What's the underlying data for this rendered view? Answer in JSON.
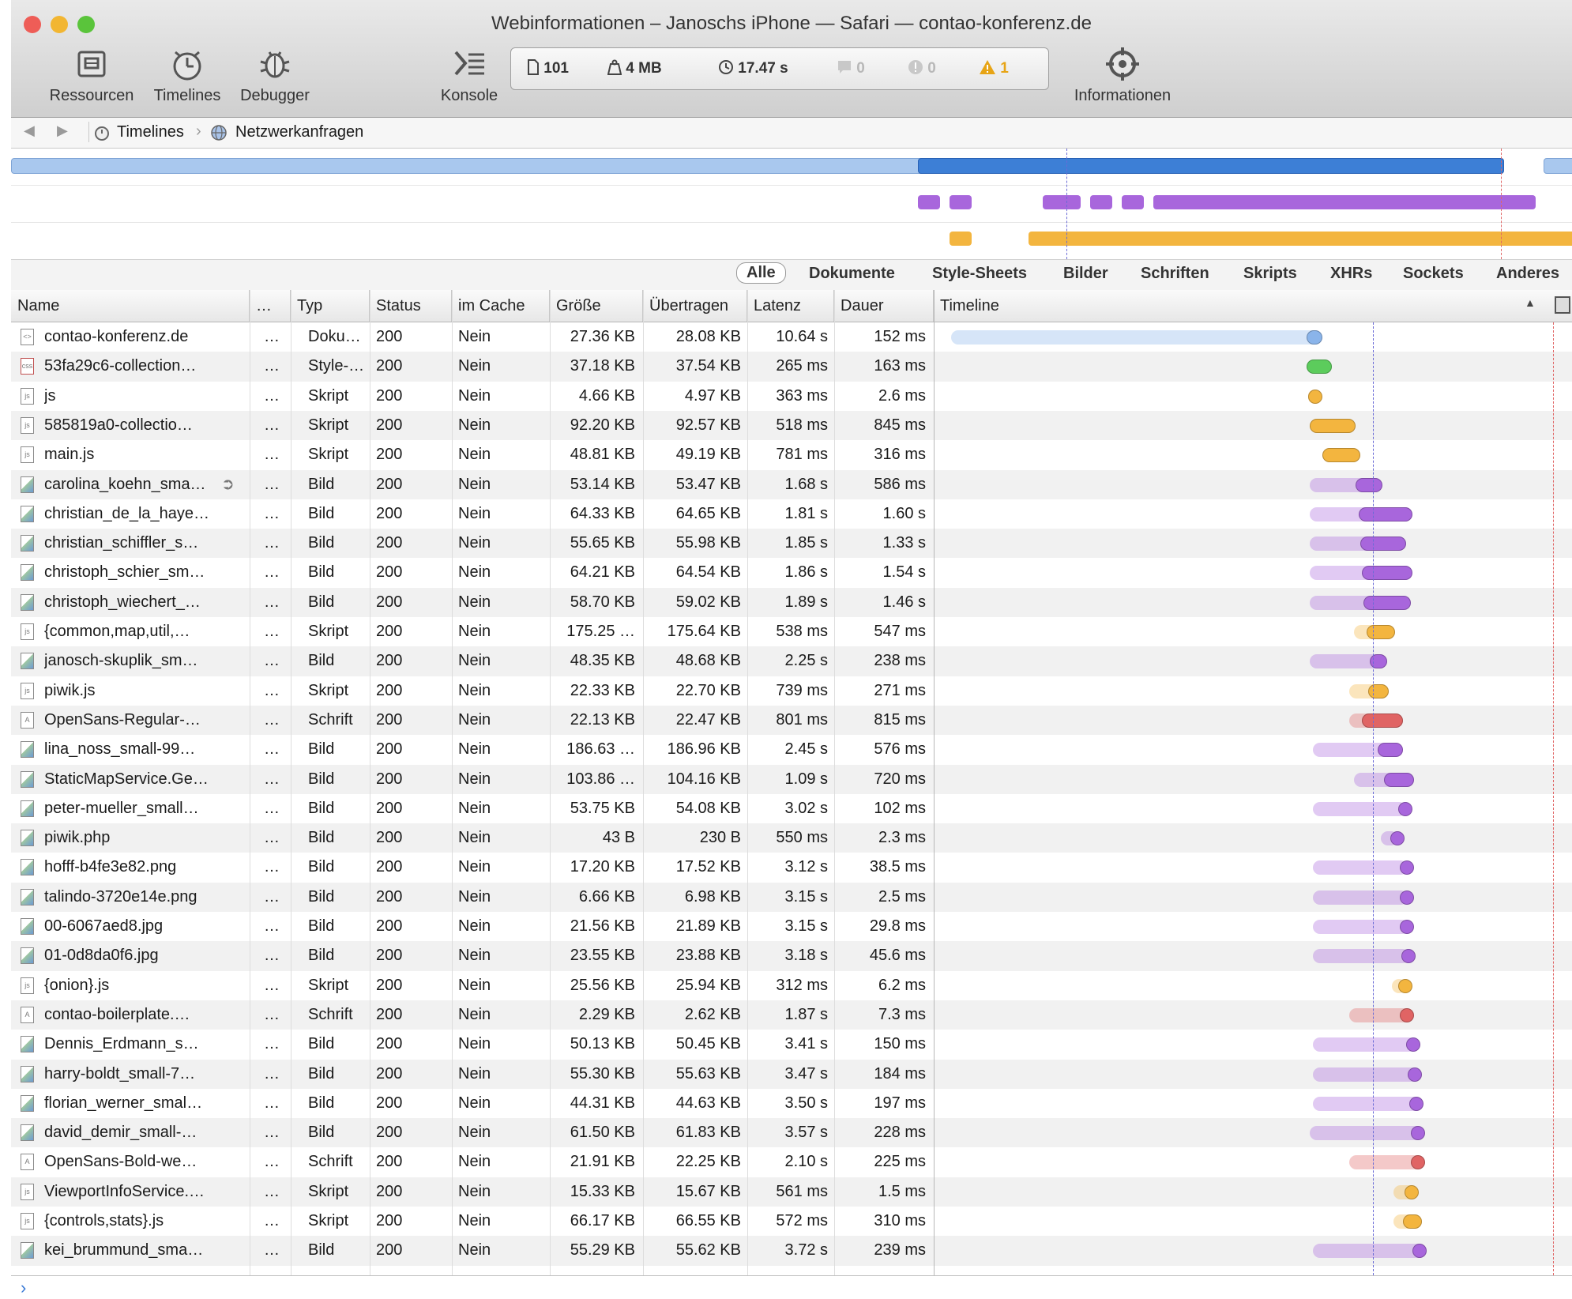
{
  "window": {
    "title": "Webinformationen – Janoschs iPhone — Safari — contao-konferenz.de",
    "traffic_colors": [
      "#ee5d57",
      "#f2b632",
      "#5ac43b"
    ]
  },
  "toolbar": {
    "resources_label": "Ressourcen",
    "timelines_label": "Timelines",
    "debugger_label": "Debugger",
    "console_label": "Konsole",
    "info_label": "Informationen"
  },
  "stats": {
    "resources": "101",
    "size": "4 MB",
    "time": "17.47 s",
    "messages": "0",
    "errors": "0",
    "warnings": "1",
    "warning_color": "#e7a415"
  },
  "breadcrumb": {
    "item1": "Timelines",
    "item2": "Netzwerkanfragen"
  },
  "filters": [
    "Alle",
    "Dokumente",
    "Style-Sheets",
    "Bilder",
    "Schriften",
    "Skripts",
    "XHRs",
    "Sockets",
    "Anderes"
  ],
  "columns": {
    "name": "Name",
    "dots": "…",
    "type": "Typ",
    "status": "Status",
    "cache": "im Cache",
    "size": "Größe",
    "transferred": "Übertragen",
    "latency": "Latenz",
    "duration": "Dauer",
    "timeline": "Timeline"
  },
  "colors": {
    "document": "#8ab4ea",
    "stylesheet": "#5ccc5c",
    "script": "#f3b53f",
    "image": "#a866dc",
    "font": "#e06464"
  },
  "rows": [
    {
      "name": "contao-konferenz.de",
      "dots": "…",
      "type": "Doku…",
      "status": "200",
      "cache": "Nein",
      "size": "27.36 KB",
      "transferred": "28.08 KB",
      "latency": "10.64 s",
      "duration": "152 ms",
      "kind": "document",
      "icon": "<>"
    },
    {
      "name": "53fa29c6-collection…",
      "dots": "…",
      "type": "Style-…",
      "status": "200",
      "cache": "Nein",
      "size": "37.18 KB",
      "transferred": "37.54 KB",
      "latency": "265 ms",
      "duration": "163 ms",
      "kind": "stylesheet",
      "icon": "css"
    },
    {
      "name": "js",
      "dots": "…",
      "type": "Skript",
      "status": "200",
      "cache": "Nein",
      "size": "4.66 KB",
      "transferred": "4.97 KB",
      "latency": "363 ms",
      "duration": "2.6 ms",
      "kind": "script",
      "icon": "js"
    },
    {
      "name": "585819a0-collectio…",
      "dots": "…",
      "type": "Skript",
      "status": "200",
      "cache": "Nein",
      "size": "92.20 KB",
      "transferred": "92.57 KB",
      "latency": "518 ms",
      "duration": "845 ms",
      "kind": "script",
      "icon": "js"
    },
    {
      "name": "main.js",
      "dots": "…",
      "type": "Skript",
      "status": "200",
      "cache": "Nein",
      "size": "48.81 KB",
      "transferred": "49.19 KB",
      "latency": "781 ms",
      "duration": "316 ms",
      "kind": "script",
      "icon": "js"
    },
    {
      "name": "carolina_koehn_sma…",
      "dots": "…",
      "type": "Bild",
      "status": "200",
      "cache": "Nein",
      "size": "53.14 KB",
      "transferred": "53.47 KB",
      "latency": "1.68 s",
      "duration": "586 ms",
      "kind": "image",
      "icon": "img"
    },
    {
      "name": "christian_de_la_haye…",
      "dots": "…",
      "type": "Bild",
      "status": "200",
      "cache": "Nein",
      "size": "64.33 KB",
      "transferred": "64.65 KB",
      "latency": "1.81 s",
      "duration": "1.60 s",
      "kind": "image",
      "icon": "img"
    },
    {
      "name": "christian_schiffler_s…",
      "dots": "…",
      "type": "Bild",
      "status": "200",
      "cache": "Nein",
      "size": "55.65 KB",
      "transferred": "55.98 KB",
      "latency": "1.85 s",
      "duration": "1.33 s",
      "kind": "image",
      "icon": "img"
    },
    {
      "name": "christoph_schier_sm…",
      "dots": "…",
      "type": "Bild",
      "status": "200",
      "cache": "Nein",
      "size": "64.21 KB",
      "transferred": "64.54 KB",
      "latency": "1.86 s",
      "duration": "1.54 s",
      "kind": "image",
      "icon": "img"
    },
    {
      "name": "christoph_wiechert_…",
      "dots": "…",
      "type": "Bild",
      "status": "200",
      "cache": "Nein",
      "size": "58.70 KB",
      "transferred": "59.02 KB",
      "latency": "1.89 s",
      "duration": "1.46 s",
      "kind": "image",
      "icon": "img"
    },
    {
      "name": "{common,map,util,…",
      "dots": "…",
      "type": "Skript",
      "status": "200",
      "cache": "Nein",
      "size": "175.25 …",
      "transferred": "175.64 KB",
      "latency": "538 ms",
      "duration": "547 ms",
      "kind": "script",
      "icon": "js"
    },
    {
      "name": "janosch-skuplik_sm…",
      "dots": "…",
      "type": "Bild",
      "status": "200",
      "cache": "Nein",
      "size": "48.35 KB",
      "transferred": "48.68 KB",
      "latency": "2.25 s",
      "duration": "238 ms",
      "kind": "image",
      "icon": "img"
    },
    {
      "name": "piwik.js",
      "dots": "…",
      "type": "Skript",
      "status": "200",
      "cache": "Nein",
      "size": "22.33 KB",
      "transferred": "22.70 KB",
      "latency": "739 ms",
      "duration": "271 ms",
      "kind": "script",
      "icon": "js"
    },
    {
      "name": "OpenSans-Regular-…",
      "dots": "…",
      "type": "Schrift",
      "status": "200",
      "cache": "Nein",
      "size": "22.13 KB",
      "transferred": "22.47 KB",
      "latency": "801 ms",
      "duration": "815 ms",
      "kind": "font",
      "icon": "A"
    },
    {
      "name": "lina_noss_small-99…",
      "dots": "…",
      "type": "Bild",
      "status": "200",
      "cache": "Nein",
      "size": "186.63 …",
      "transferred": "186.96 KB",
      "latency": "2.45 s",
      "duration": "576 ms",
      "kind": "image",
      "icon": "img"
    },
    {
      "name": "StaticMapService.Ge…",
      "dots": "…",
      "type": "Bild",
      "status": "200",
      "cache": "Nein",
      "size": "103.86 …",
      "transferred": "104.16 KB",
      "latency": "1.09 s",
      "duration": "720 ms",
      "kind": "image",
      "icon": "img"
    },
    {
      "name": "peter-mueller_small…",
      "dots": "…",
      "type": "Bild",
      "status": "200",
      "cache": "Nein",
      "size": "53.75 KB",
      "transferred": "54.08 KB",
      "latency": "3.02 s",
      "duration": "102 ms",
      "kind": "image",
      "icon": "img"
    },
    {
      "name": "piwik.php",
      "dots": "…",
      "type": "Bild",
      "status": "200",
      "cache": "Nein",
      "size": "43 B",
      "transferred": "230 B",
      "latency": "550 ms",
      "duration": "2.3 ms",
      "kind": "image",
      "icon": "img"
    },
    {
      "name": "hofff-b4fe3e82.png",
      "dots": "…",
      "type": "Bild",
      "status": "200",
      "cache": "Nein",
      "size": "17.20 KB",
      "transferred": "17.52 KB",
      "latency": "3.12 s",
      "duration": "38.5 ms",
      "kind": "image",
      "icon": "img"
    },
    {
      "name": "talindo-3720e14e.png",
      "dots": "…",
      "type": "Bild",
      "status": "200",
      "cache": "Nein",
      "size": "6.66 KB",
      "transferred": "6.98 KB",
      "latency": "3.15 s",
      "duration": "2.5 ms",
      "kind": "image",
      "icon": "img"
    },
    {
      "name": "00-6067aed8.jpg",
      "dots": "…",
      "type": "Bild",
      "status": "200",
      "cache": "Nein",
      "size": "21.56 KB",
      "transferred": "21.89 KB",
      "latency": "3.15 s",
      "duration": "29.8 ms",
      "kind": "image",
      "icon": "img"
    },
    {
      "name": "01-0d8da0f6.jpg",
      "dots": "…",
      "type": "Bild",
      "status": "200",
      "cache": "Nein",
      "size": "23.55 KB",
      "transferred": "23.88 KB",
      "latency": "3.18 s",
      "duration": "45.6 ms",
      "kind": "image",
      "icon": "img"
    },
    {
      "name": "{onion}.js",
      "dots": "…",
      "type": "Skript",
      "status": "200",
      "cache": "Nein",
      "size": "25.56 KB",
      "transferred": "25.94 KB",
      "latency": "312 ms",
      "duration": "6.2 ms",
      "kind": "script",
      "icon": "js"
    },
    {
      "name": "contao-boilerplate.…",
      "dots": "…",
      "type": "Schrift",
      "status": "200",
      "cache": "Nein",
      "size": "2.29 KB",
      "transferred": "2.62 KB",
      "latency": "1.87 s",
      "duration": "7.3 ms",
      "kind": "font",
      "icon": "A"
    },
    {
      "name": "Dennis_Erdmann_s…",
      "dots": "…",
      "type": "Bild",
      "status": "200",
      "cache": "Nein",
      "size": "50.13 KB",
      "transferred": "50.45 KB",
      "latency": "3.41 s",
      "duration": "150 ms",
      "kind": "image",
      "icon": "img"
    },
    {
      "name": "harry-boldt_small-7…",
      "dots": "…",
      "type": "Bild",
      "status": "200",
      "cache": "Nein",
      "size": "55.30 KB",
      "transferred": "55.63 KB",
      "latency": "3.47 s",
      "duration": "184 ms",
      "kind": "image",
      "icon": "img"
    },
    {
      "name": "florian_werner_smal…",
      "dots": "…",
      "type": "Bild",
      "status": "200",
      "cache": "Nein",
      "size": "44.31 KB",
      "transferred": "44.63 KB",
      "latency": "3.50 s",
      "duration": "197 ms",
      "kind": "image",
      "icon": "img"
    },
    {
      "name": "david_demir_small-…",
      "dots": "…",
      "type": "Bild",
      "status": "200",
      "cache": "Nein",
      "size": "61.50 KB",
      "transferred": "61.83 KB",
      "latency": "3.57 s",
      "duration": "228 ms",
      "kind": "image",
      "icon": "img"
    },
    {
      "name": "OpenSans-Bold-we…",
      "dots": "…",
      "type": "Schrift",
      "status": "200",
      "cache": "Nein",
      "size": "21.91 KB",
      "transferred": "22.25 KB",
      "latency": "2.10 s",
      "duration": "225 ms",
      "kind": "font",
      "icon": "A"
    },
    {
      "name": "ViewportInfoService.…",
      "dots": "…",
      "type": "Skript",
      "status": "200",
      "cache": "Nein",
      "size": "15.33 KB",
      "transferred": "15.67 KB",
      "latency": "561 ms",
      "duration": "1.5 ms",
      "kind": "script",
      "icon": "js"
    },
    {
      "name": "{controls,stats}.js",
      "dots": "…",
      "type": "Skript",
      "status": "200",
      "cache": "Nein",
      "size": "66.17 KB",
      "transferred": "66.55 KB",
      "latency": "572 ms",
      "duration": "310 ms",
      "kind": "script",
      "icon": "js"
    },
    {
      "name": "kei_brummund_sma…",
      "dots": "…",
      "type": "Bild",
      "status": "200",
      "cache": "Nein",
      "size": "55.29 KB",
      "transferred": "55.62 KB",
      "latency": "3.72 s",
      "duration": "239 ms",
      "kind": "image",
      "icon": "img"
    }
  ]
}
